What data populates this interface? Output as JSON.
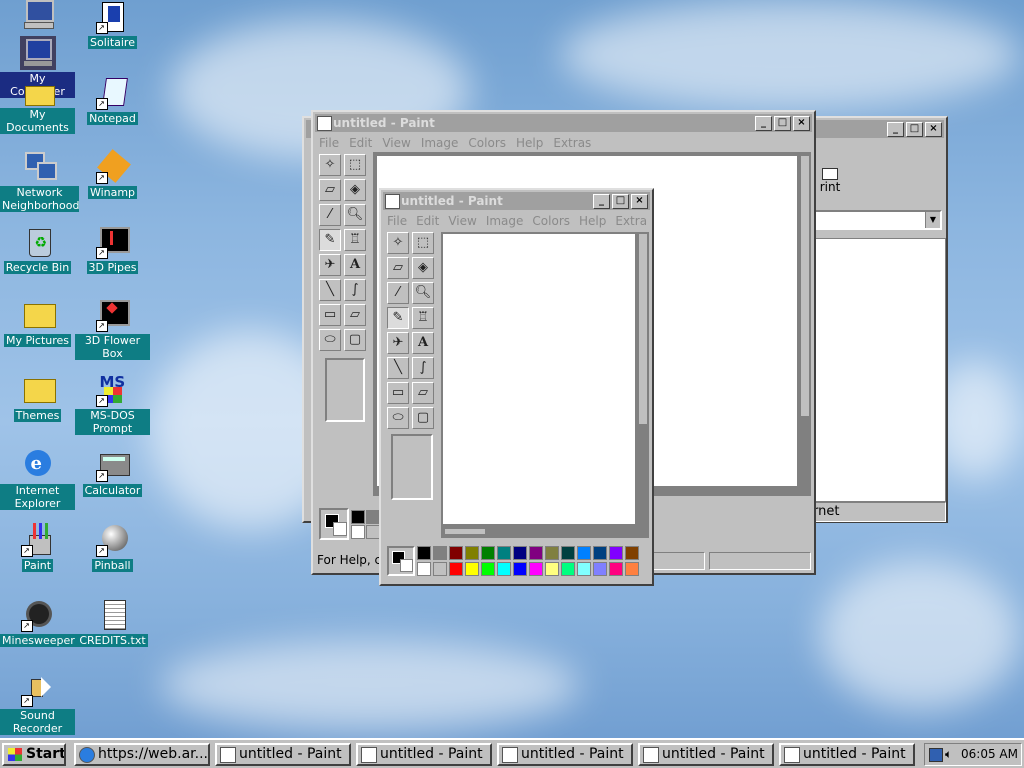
{
  "desktop": {
    "icons": [
      {
        "label": "My Computer",
        "icon": "computer-icon"
      },
      {
        "label": "Solitaire",
        "icon": "solitaire-icon"
      },
      {
        "label": "My Documents",
        "icon": "folder-icon"
      },
      {
        "label": "Notepad",
        "icon": "notepad-icon"
      },
      {
        "label": "Network Neighborhood",
        "icon": "network-icon"
      },
      {
        "label": "Winamp",
        "icon": "winamp-icon"
      },
      {
        "label": "Recycle Bin",
        "icon": "recycle-bin-icon"
      },
      {
        "label": "3D Pipes",
        "icon": "screensaver-icon"
      },
      {
        "label": "My Pictures",
        "icon": "folder-icon"
      },
      {
        "label": "3D Flower Box",
        "icon": "screensaver-icon"
      },
      {
        "label": "Themes",
        "icon": "folder-icon"
      },
      {
        "label": "MS-DOS Prompt",
        "icon": "msdos-icon"
      },
      {
        "label": "Internet Explorer",
        "icon": "ie-icon"
      },
      {
        "label": "Calculator",
        "icon": "calculator-icon"
      },
      {
        "label": "Paint",
        "icon": "paint-icon"
      },
      {
        "label": "Pinball",
        "icon": "pinball-icon"
      },
      {
        "label": "Minesweeper",
        "icon": "minesweeper-icon"
      },
      {
        "label": "CREDITS.txt",
        "icon": "text-file-icon"
      },
      {
        "label": "Sound Recorder",
        "icon": "sound-recorder-icon"
      }
    ]
  },
  "paint_back": {
    "title": "untitled - Paint",
    "menu": [
      "File",
      "Edit",
      "View",
      "Image",
      "Colors",
      "Help",
      "Extras"
    ],
    "status": "For Help, c"
  },
  "paint_front": {
    "title": "untitled - Paint",
    "menu": [
      "File",
      "Edit",
      "View",
      "Image",
      "Colors",
      "Help",
      "Extra"
    ]
  },
  "ie_window": {
    "print_label": "rint",
    "status": "ernet"
  },
  "palette_top": [
    "#000000",
    "#808080",
    "#800000",
    "#808000",
    "#008000",
    "#008080",
    "#000080",
    "#800080",
    "#808040",
    "#004040",
    "#0080ff",
    "#004080",
    "#8000ff",
    "#804000"
  ],
  "palette_bottom": [
    "#ffffff",
    "#c0c0c0",
    "#ff0000",
    "#ffff00",
    "#00ff00",
    "#00ffff",
    "#0000ff",
    "#ff00ff",
    "#ffff80",
    "#00ff80",
    "#80ffff",
    "#8080ff",
    "#ff0080",
    "#ff8040"
  ],
  "taskbar": {
    "start": "Start",
    "items": [
      "https://web.ar...",
      "untitled - Paint",
      "untitled - Paint",
      "untitled - Paint",
      "untitled - Paint",
      "untitled - Paint"
    ],
    "clock": "06:05 AM"
  }
}
